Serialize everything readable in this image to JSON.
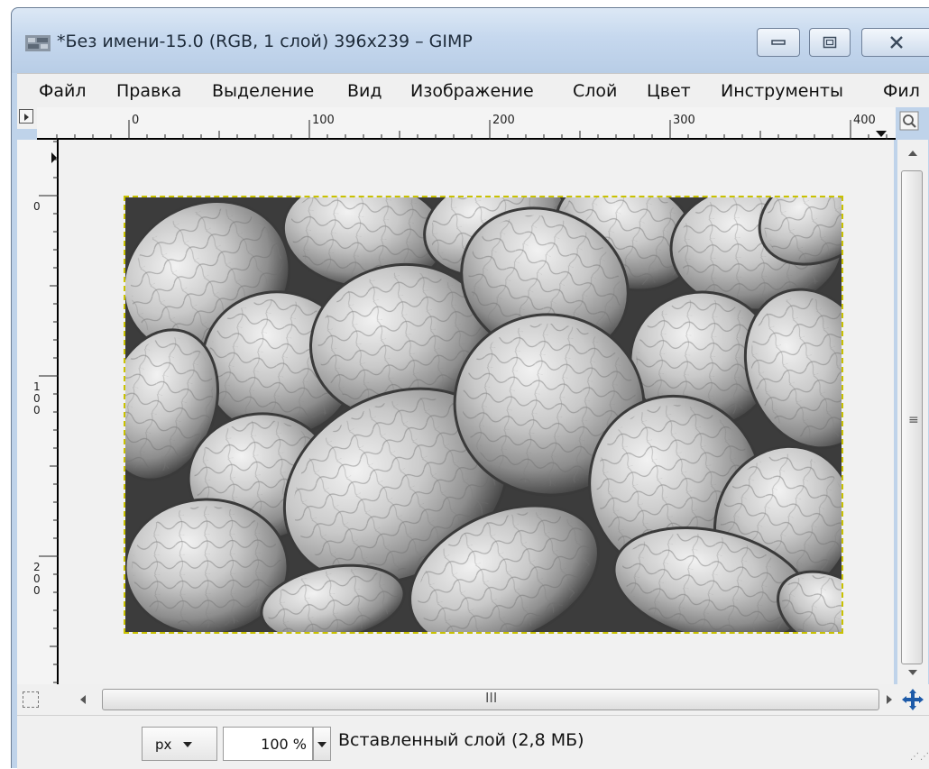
{
  "window": {
    "title": "*Без имени-15.0 (RGB, 1 слой) 396x239 – GIMP"
  },
  "menu": {
    "items": [
      {
        "label": "Файл"
      },
      {
        "label": "Правка"
      },
      {
        "label": "Выделение"
      },
      {
        "label": "Вид"
      },
      {
        "label": "Изображение"
      },
      {
        "label": "Слой"
      },
      {
        "label": "Цвет"
      },
      {
        "label": "Инструменты"
      },
      {
        "label": "Фил"
      }
    ]
  },
  "rulers": {
    "horizontal_labels": [
      "0",
      "100",
      "200",
      "300",
      "400"
    ],
    "vertical_labels": [
      "0",
      "100",
      "200"
    ]
  },
  "statusbar": {
    "unit": "px",
    "zoom": "100 %",
    "layer_info": "Вставленный слой (2,8 МБ)"
  },
  "scrollbar": {
    "grip": "III"
  },
  "icons": {
    "app": "gimp-image-icon",
    "menu_toggle": "menu-arrow-icon",
    "zoom_toggle": "zoom-magnifier-icon",
    "navigate": "navigate-move-icon",
    "quick_mask": "quick-mask-icon"
  }
}
